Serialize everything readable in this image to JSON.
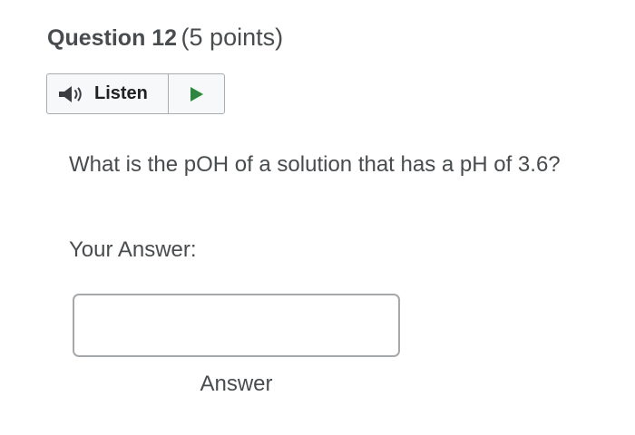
{
  "question": {
    "number_label": "Question 12",
    "points_label": "(5 points)",
    "text": "What is the pOH of a solution that has a pH of 3.6?"
  },
  "listen": {
    "label": "Listen",
    "speaker_icon": "speaker-icon",
    "play_icon": "play-icon",
    "play_color": "#2e8540"
  },
  "answer": {
    "label": "Your Answer:",
    "value": "",
    "caption": "Answer"
  }
}
